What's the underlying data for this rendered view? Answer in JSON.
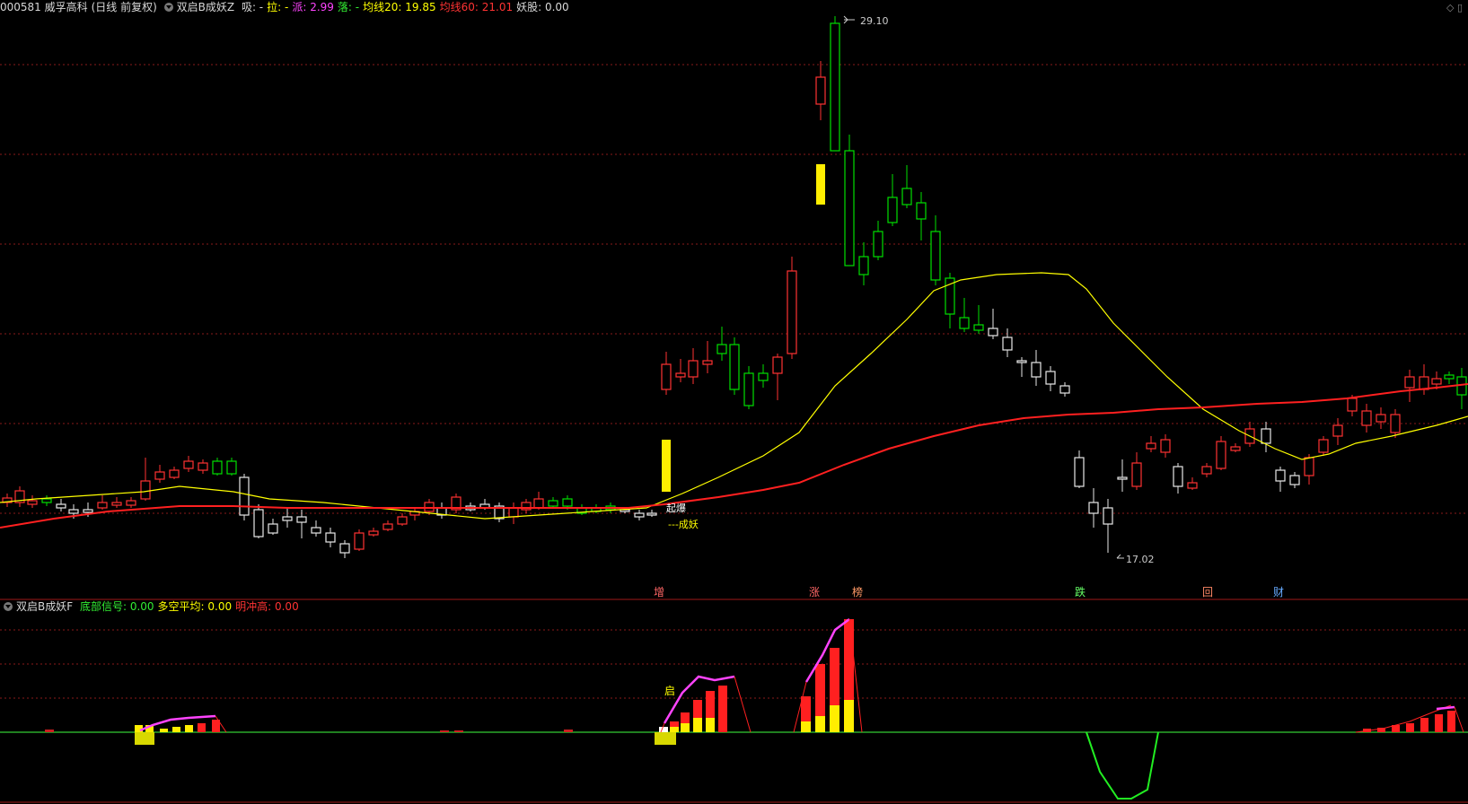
{
  "main_header": {
    "code_name": "000581 威孚高科",
    "period": "(日线 前复权)",
    "indicator_name": "双启B成妖Z",
    "items": [
      {
        "label": "吸:",
        "value": "-",
        "color": "#d8d8d8"
      },
      {
        "label": "拉:",
        "value": "-",
        "color": "#ffff00"
      },
      {
        "label": "派:",
        "value": "2.99",
        "color": "#ff44ff"
      },
      {
        "label": "落:",
        "value": "-",
        "color": "#33ee33"
      },
      {
        "label": "均线20:",
        "value": "19.85",
        "color": "#ffff00"
      },
      {
        "label": "均线60:",
        "value": "21.01",
        "color": "#ff3333"
      },
      {
        "label": "妖股:",
        "value": "0.00",
        "color": "#d8d8d8"
      }
    ]
  },
  "sub_header": {
    "indicator_name": "双启B成妖F",
    "items": [
      {
        "label": "底部信号:",
        "value": "0.00",
        "color": "#33ee33"
      },
      {
        "label": "多空平均:",
        "value": "0.00",
        "color": "#ffff00"
      },
      {
        "label": "明冲高:",
        "value": "0.00",
        "color": "#ff3333"
      }
    ]
  },
  "annotations": {
    "high": "29.10",
    "low": "17.02",
    "explode": "起爆",
    "become": "---成妖",
    "qi": "启"
  },
  "markers": [
    {
      "text": "增",
      "color": "#ff6666"
    },
    {
      "text": "涨",
      "color": "#ff6666"
    },
    {
      "text": "榜",
      "color": "#ff9966"
    },
    {
      "text": "跌",
      "color": "#66ff66"
    },
    {
      "text": "回",
      "color": "#ff8866"
    },
    {
      "text": "财",
      "color": "#66aaff"
    }
  ],
  "colors": {
    "up": "#ff3232",
    "down": "#00e000",
    "neutral": "#e8e8e8",
    "ma20": "#ffff00",
    "ma60": "#ff2020",
    "grid": "#8a1a1a"
  }
}
